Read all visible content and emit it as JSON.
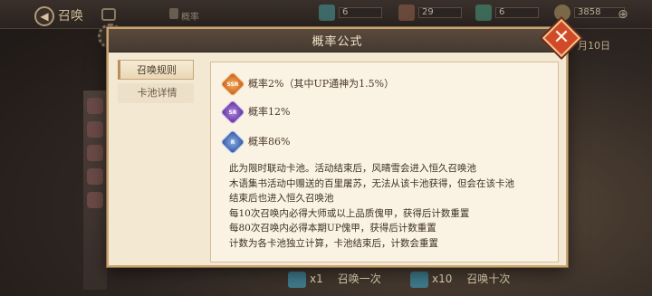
{
  "background": {
    "title": "召唤",
    "probability_label": "概率",
    "resources": [
      "6",
      "29",
      "6",
      "3858"
    ],
    "date": "月10日",
    "single_summon": {
      "count": "x1",
      "label": "召唤一次"
    },
    "ten_summon": {
      "count": "x10",
      "label": "召唤十次"
    }
  },
  "modal": {
    "title": "概率公式",
    "close_icon": "close-icon",
    "tabs": [
      {
        "label": "召唤规则",
        "active": true
      },
      {
        "label": "卡池详情",
        "active": false
      }
    ],
    "rates": [
      {
        "rarity": "SSR",
        "text": "概率2%（其中UP通神为1.5%）"
      },
      {
        "rarity": "SR",
        "text": "概率12%"
      },
      {
        "rarity": "R",
        "text": "概率86%"
      }
    ],
    "description": [
      "此为限时联动卡池。活动结束后，风晴雪会进入恒久召唤池",
      "木语集书活动中赠送的百里屠苏，无法从该卡池获得，但会在该卡池",
      "结束后也进入恒久召唤池",
      "每10次召唤内必得大师或以上品质傀甲，获得后计数重置",
      "每80次召唤内必得本期UP傀甲，获得后计数重置",
      "计数为各卡池独立计算，卡池结束后，计数会重置"
    ]
  }
}
